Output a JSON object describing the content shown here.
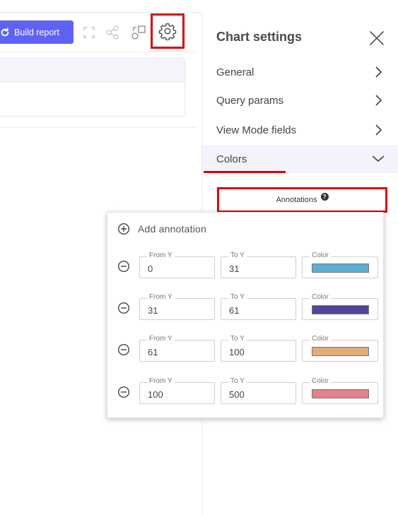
{
  "toolbar": {
    "build_report_label": "Build report",
    "icons": [
      "fullscreen-icon",
      "share-icon",
      "export-icon",
      "gear-icon"
    ]
  },
  "settings": {
    "title": "Chart settings",
    "sections": [
      {
        "label": "General",
        "expanded": false
      },
      {
        "label": "Query params",
        "expanded": false
      },
      {
        "label": "View Mode fields",
        "expanded": false
      },
      {
        "label": "Colors",
        "expanded": true
      }
    ],
    "annotations_label": "Annotations",
    "help_glyph": "?"
  },
  "annotations_popover": {
    "add_label": "Add annotation",
    "from_label": "From Y",
    "to_label": "To Y",
    "color_label": "Color",
    "rows": [
      {
        "from": "0",
        "to": "31",
        "color": "#5ab1d6"
      },
      {
        "from": "31",
        "to": "61",
        "color": "#54439a"
      },
      {
        "from": "61",
        "to": "100",
        "color": "#e2ad79"
      },
      {
        "from": "100",
        "to": "500",
        "color": "#e08389"
      }
    ]
  },
  "colors": {
    "accent": "#5f63f5",
    "highlight": "#e00000"
  }
}
